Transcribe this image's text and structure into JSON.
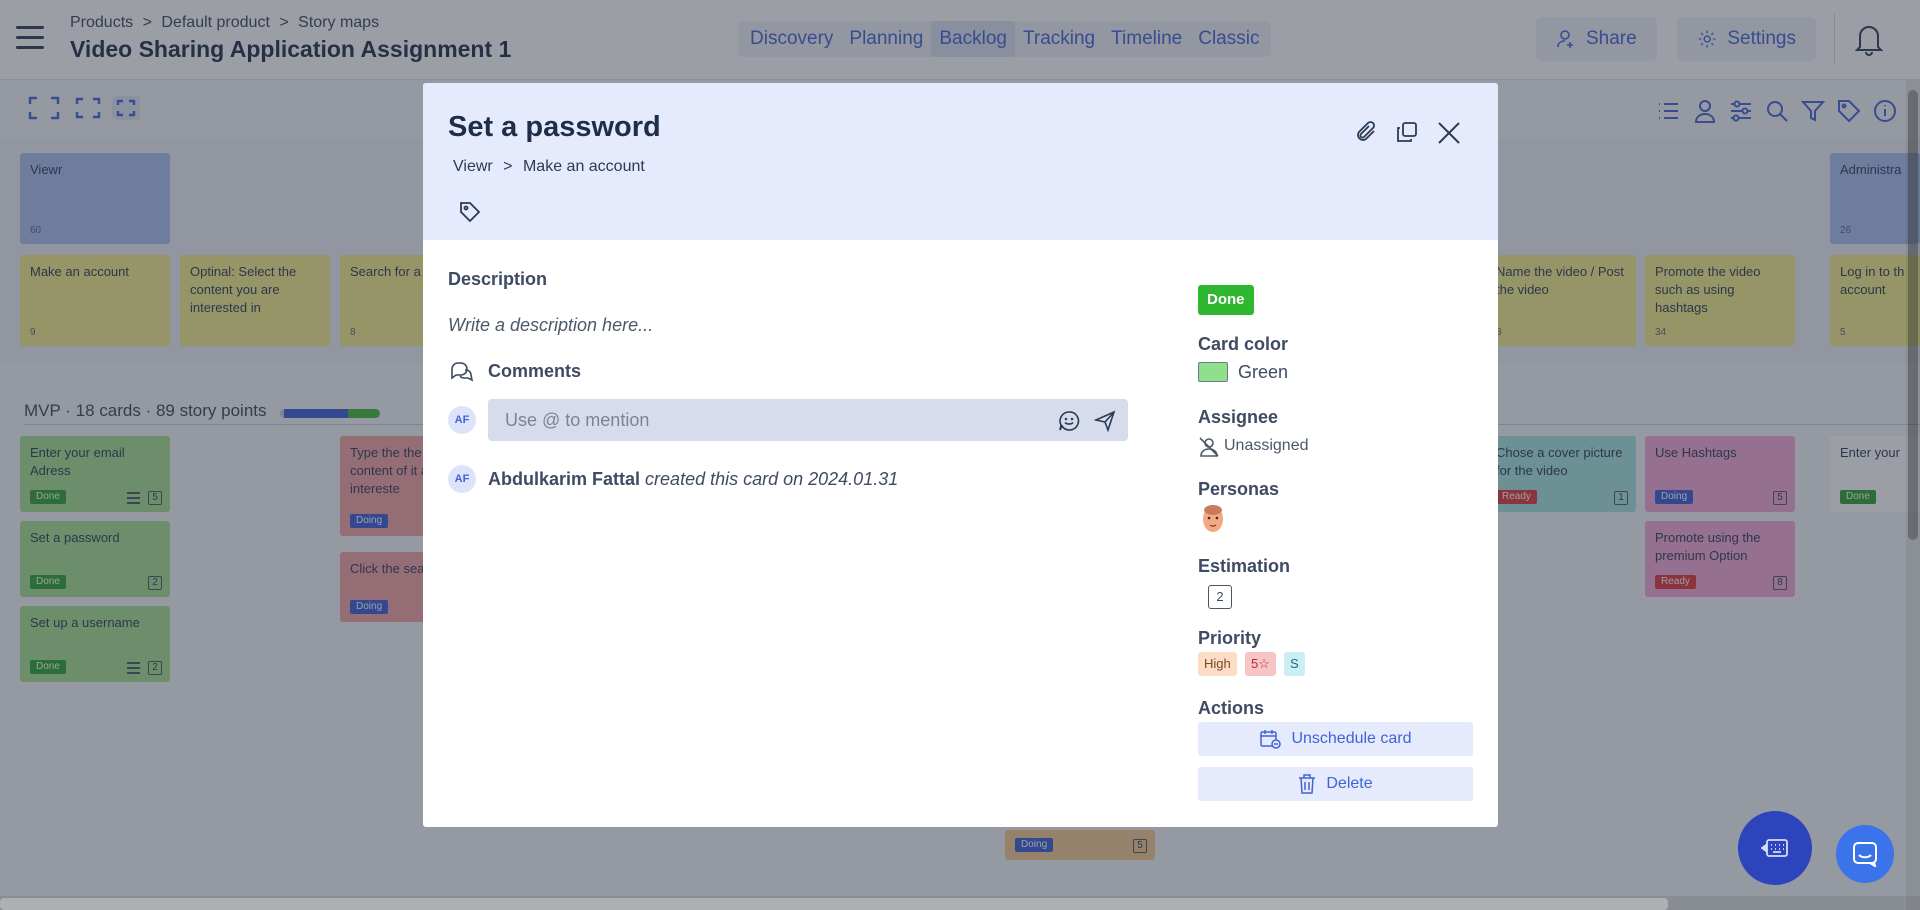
{
  "header": {
    "breadcrumb": [
      "Products",
      ">",
      "Default product",
      ">",
      "Story maps"
    ],
    "title": "Video Sharing Application Assignment 1",
    "tabs": [
      {
        "label": "Discovery",
        "active": false
      },
      {
        "label": "Planning",
        "active": false
      },
      {
        "label": "Backlog",
        "active": true
      },
      {
        "label": "Tracking",
        "active": false
      },
      {
        "label": "Timeline",
        "active": false
      },
      {
        "label": "Classic",
        "active": false
      }
    ],
    "share_label": "Share",
    "settings_label": "Settings"
  },
  "board": {
    "personas": [
      {
        "label": "Viewr",
        "count": "60"
      },
      {
        "label": "Administra",
        "count": "26"
      }
    ],
    "activities": [
      {
        "label": "Make an account",
        "count": "9"
      },
      {
        "label": "Optinal: Select the content you are interested in",
        "count": ""
      },
      {
        "label": "Search for a",
        "count": "8"
      },
      {
        "label": "Name the video / Post the video",
        "count": "8"
      },
      {
        "label": "Promote the video such as using hashtags",
        "count": "34"
      },
      {
        "label": "Log in to th account",
        "count": "5"
      }
    ],
    "release": {
      "label": "MVP · 18 cards · 89 story points"
    },
    "stories": [
      {
        "label": "Enter your email Adress",
        "status": "Done",
        "estimate": "5"
      },
      {
        "label": "Set a password",
        "status": "Done",
        "estimate": "2"
      },
      {
        "label": "Set up a username",
        "status": "Done",
        "estimate": "2"
      },
      {
        "label": "Type the the video or content of it are intereste",
        "status": "Doing",
        "estimate": ""
      },
      {
        "label": "Click the sea",
        "status": "Doing",
        "estimate": ""
      },
      {
        "label": "Chose a cover picture for the video",
        "status": "Ready",
        "estimate": "1"
      },
      {
        "label": "Use Hashtags",
        "status": "Doing",
        "estimate": "5"
      },
      {
        "label": "Promote using the premium Option",
        "status": "Ready",
        "estimate": "8"
      },
      {
        "label": "Enter your",
        "status": "Done",
        "estimate": ""
      },
      {
        "label": "",
        "status": "Doing",
        "estimate": "5"
      }
    ]
  },
  "modal": {
    "title": "Set a password",
    "path": [
      "Viewr",
      ">",
      "Make an account"
    ],
    "description_label": "Description",
    "description_placeholder": "Write a description here...",
    "comments_label": "Comments",
    "avatar_initials": "AF",
    "comment_placeholder": "Use @ to mention",
    "activity": {
      "author": "Abdulkarim Fattal",
      "text": "created this card on 2024.01.31"
    },
    "status": "Done",
    "card_color_label": "Card color",
    "card_color_name": "Green",
    "card_color_hex": "#8ee08a",
    "assignee_label": "Assignee",
    "assignee_value": "Unassigned",
    "personas_label": "Personas",
    "estimation_label": "Estimation",
    "estimation_value": "2",
    "priority_label": "Priority",
    "priority_chips": [
      "High",
      "5",
      "S"
    ],
    "actions_label": "Actions",
    "unschedule_label": "Unschedule card",
    "delete_label": "Delete"
  },
  "colors": {
    "accent": "#4163d6",
    "done": "#2fb82f",
    "doing": "#3b5bd6",
    "ready": "#e0353b"
  }
}
